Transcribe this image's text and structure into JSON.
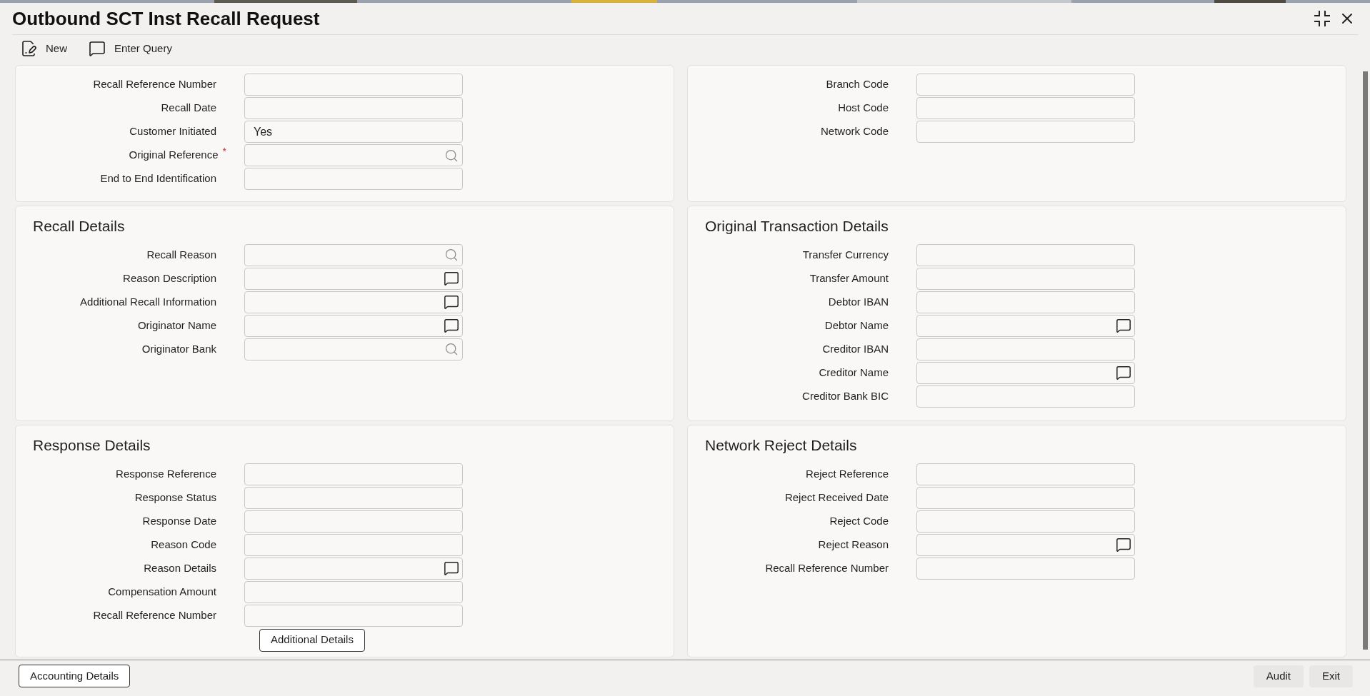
{
  "window": {
    "title": "Outbound SCT Inst Recall Request"
  },
  "toolbar": [
    {
      "label": "New",
      "kind": "new"
    },
    {
      "label": "Enter Query",
      "kind": "query"
    }
  ],
  "rows": [
    {
      "left": {
        "fields": [
          {
            "label": "Recall Reference Number",
            "kind": "text"
          },
          {
            "label": "Recall Date",
            "kind": "text"
          },
          {
            "label": "Customer Initiated",
            "kind": "text",
            "value": "Yes"
          },
          {
            "label": "Original Reference",
            "kind": "search",
            "required_mark": "*"
          },
          {
            "label": "End to End Identification",
            "kind": "text"
          }
        ]
      },
      "right": {
        "fields": [
          {
            "label": "Branch Code",
            "kind": "text"
          },
          {
            "label": "Host Code",
            "kind": "text"
          },
          {
            "label": "Network Code",
            "kind": "text"
          }
        ]
      }
    },
    {
      "left": {
        "title": "Recall Details",
        "fields": [
          {
            "label": "Recall Reason",
            "kind": "search"
          },
          {
            "label": "Reason Description",
            "kind": "note"
          },
          {
            "label": "Additional Recall Information",
            "kind": "note"
          },
          {
            "label": "Originator Name",
            "kind": "note"
          },
          {
            "label": "Originator Bank",
            "kind": "search"
          }
        ]
      },
      "right": {
        "title": "Original Transaction Details",
        "fields": [
          {
            "label": "Transfer Currency",
            "kind": "text"
          },
          {
            "label": "Transfer Amount",
            "kind": "text"
          },
          {
            "label": "Debtor IBAN",
            "kind": "text"
          },
          {
            "label": "Debtor Name",
            "kind": "note"
          },
          {
            "label": "Creditor IBAN",
            "kind": "text"
          },
          {
            "label": "Creditor Name",
            "kind": "note"
          },
          {
            "label": "Creditor Bank BIC",
            "kind": "text"
          }
        ]
      }
    },
    {
      "left": {
        "title": "Response Details",
        "fields": [
          {
            "label": "Response Reference",
            "kind": "text"
          },
          {
            "label": "Response Status",
            "kind": "text"
          },
          {
            "label": "Response Date",
            "kind": "text"
          },
          {
            "label": "Reason Code",
            "kind": "text"
          },
          {
            "label": "Reason Details",
            "kind": "note"
          },
          {
            "label": "Compensation Amount",
            "kind": "text"
          },
          {
            "label": "Recall Reference Number",
            "kind": "text"
          }
        ],
        "button": "Additional Details"
      },
      "right": {
        "title": "Network Reject Details",
        "fields": [
          {
            "label": "Reject Reference",
            "kind": "text"
          },
          {
            "label": "Reject Received Date",
            "kind": "text"
          },
          {
            "label": "Reject Code",
            "kind": "text"
          },
          {
            "label": "Reject Reason",
            "kind": "note"
          },
          {
            "label": "Recall Reference Number",
            "kind": "text"
          }
        ]
      }
    }
  ],
  "footer": {
    "left_button": "Accounting Details",
    "right_buttons": [
      "Audit",
      "Exit"
    ]
  }
}
